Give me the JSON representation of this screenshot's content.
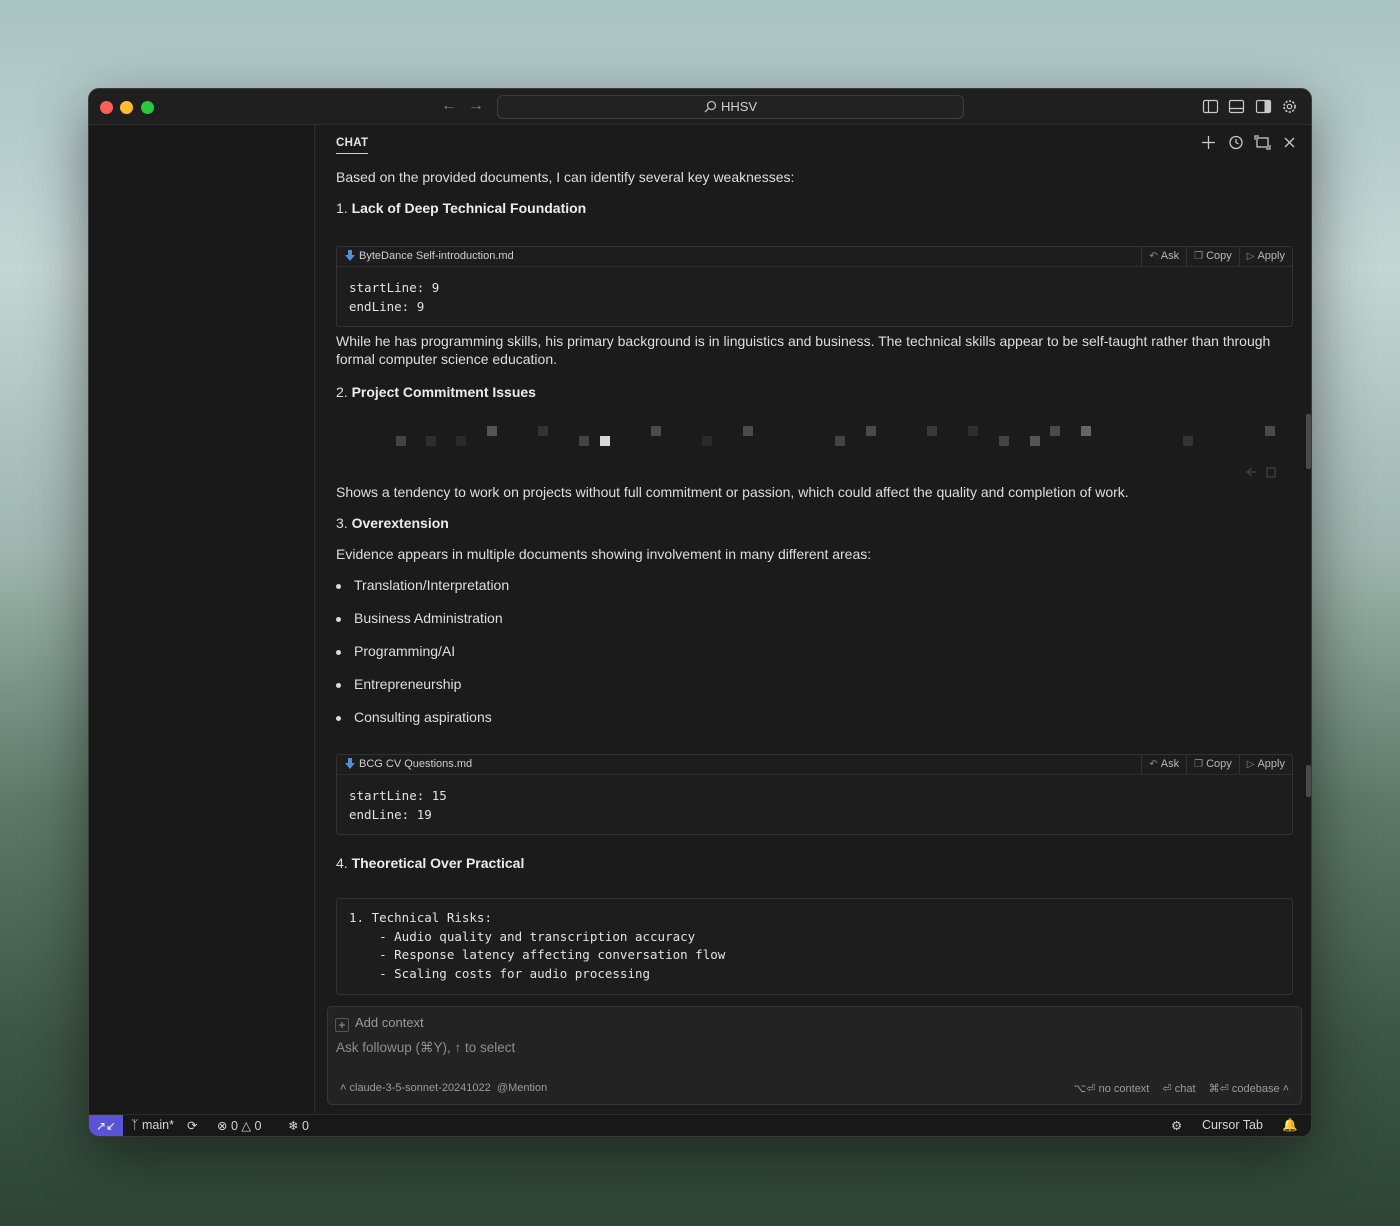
{
  "window": {
    "search_text": "HHSV"
  },
  "chat": {
    "tab_label": "CHAT",
    "intro": "Based on the provided documents, I can identify several key weaknesses:",
    "section1": {
      "num": "1.",
      "title": "Lack of Deep Technical Foundation"
    },
    "code1": {
      "file": "ByteDance Self-introduction.md",
      "ask": "Ask",
      "copy": "Copy",
      "apply": "Apply",
      "code": "startLine: 9\nendLine: 9"
    },
    "para1": "While he has programming skills, his primary background is in linguistics and business. The technical skills appear to be self-taught rather than through formal computer science education.",
    "section2": {
      "num": "2.",
      "title": "Project Commitment Issues"
    },
    "para2": "Shows a tendency to work on projects without full commitment or passion, which could affect the quality and completion of work.",
    "section3": {
      "num": "3.",
      "title": "Overextension"
    },
    "para3": "Evidence appears in multiple documents showing involvement in many different areas:",
    "bullets": [
      "Translation/Interpretation",
      "Business Administration",
      "Programming/AI",
      "Entrepreneurship",
      "Consulting aspirations"
    ],
    "code2": {
      "file": "BCG CV Questions.md",
      "ask": "Ask",
      "copy": "Copy",
      "apply": "Apply",
      "code": "startLine: 15\nendLine: 19"
    },
    "section4": {
      "num": "4.",
      "title": "Theoretical Over Practical"
    },
    "code3": {
      "code": "1. Technical Risks:\n    - Audio quality and transcription accuracy\n    - Response latency affecting conversation flow\n    - Scaling costs for audio processing"
    }
  },
  "input": {
    "add_context": "Add context",
    "placeholder": "Ask followup (⌘Y), ↑ to select",
    "model": "claude-3-5-sonnet-20241022",
    "mention": "@Mention",
    "no_context": "⌥⏎ no context",
    "chat": "⏎ chat",
    "codebase": "⌘⏎ codebase"
  },
  "statusbar": {
    "branch": "main*",
    "errors": "0",
    "warnings": "0",
    "ports": "0",
    "cursor_tab": "Cursor Tab"
  },
  "colors": {
    "remote_indicator": "#5a53d6",
    "background": "#1b1b1b"
  }
}
